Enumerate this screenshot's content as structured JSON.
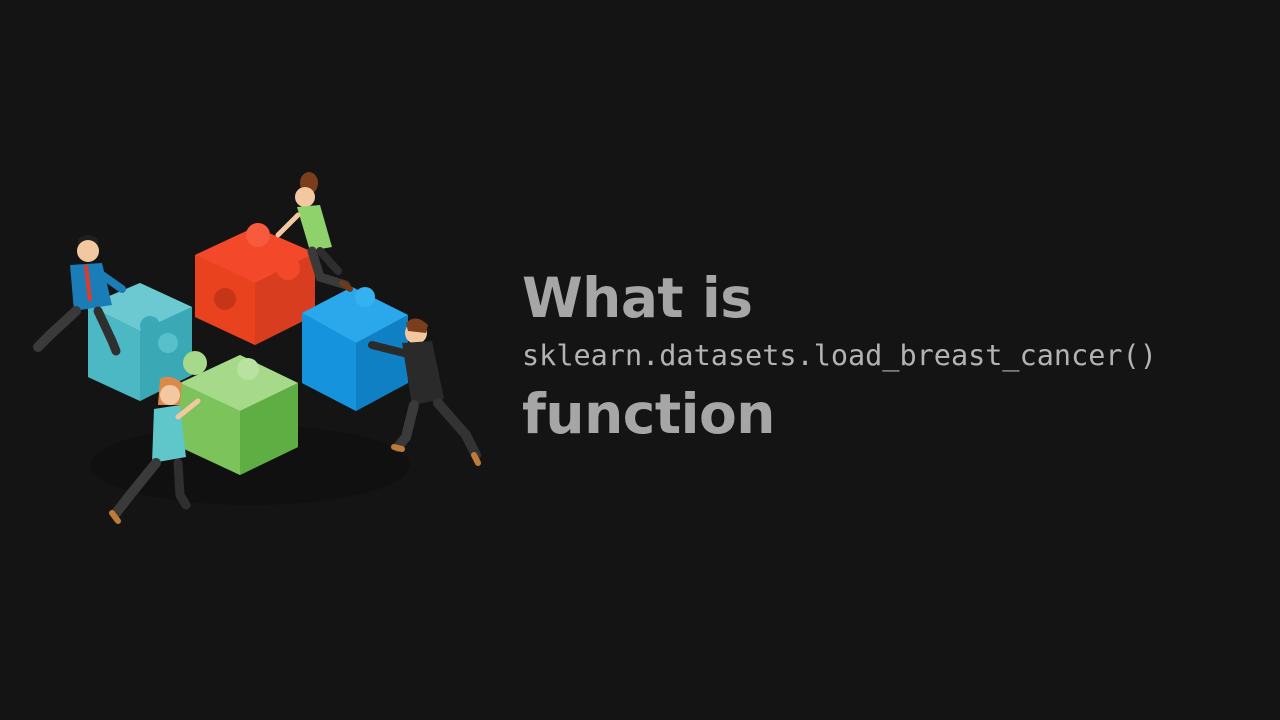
{
  "slide": {
    "title_prefix": "What is",
    "title_code": "sklearn.datasets.load_breast_cancer()",
    "title_suffix": "function",
    "text_color": "#a6a6a6",
    "background_color": "#141414"
  },
  "illustration": {
    "subject": "puzzle-team-icon",
    "piece_colors": {
      "red": "#f4482a",
      "teal": "#4bb8c4",
      "blue": "#1593dd",
      "green": "#7cc35c"
    }
  }
}
